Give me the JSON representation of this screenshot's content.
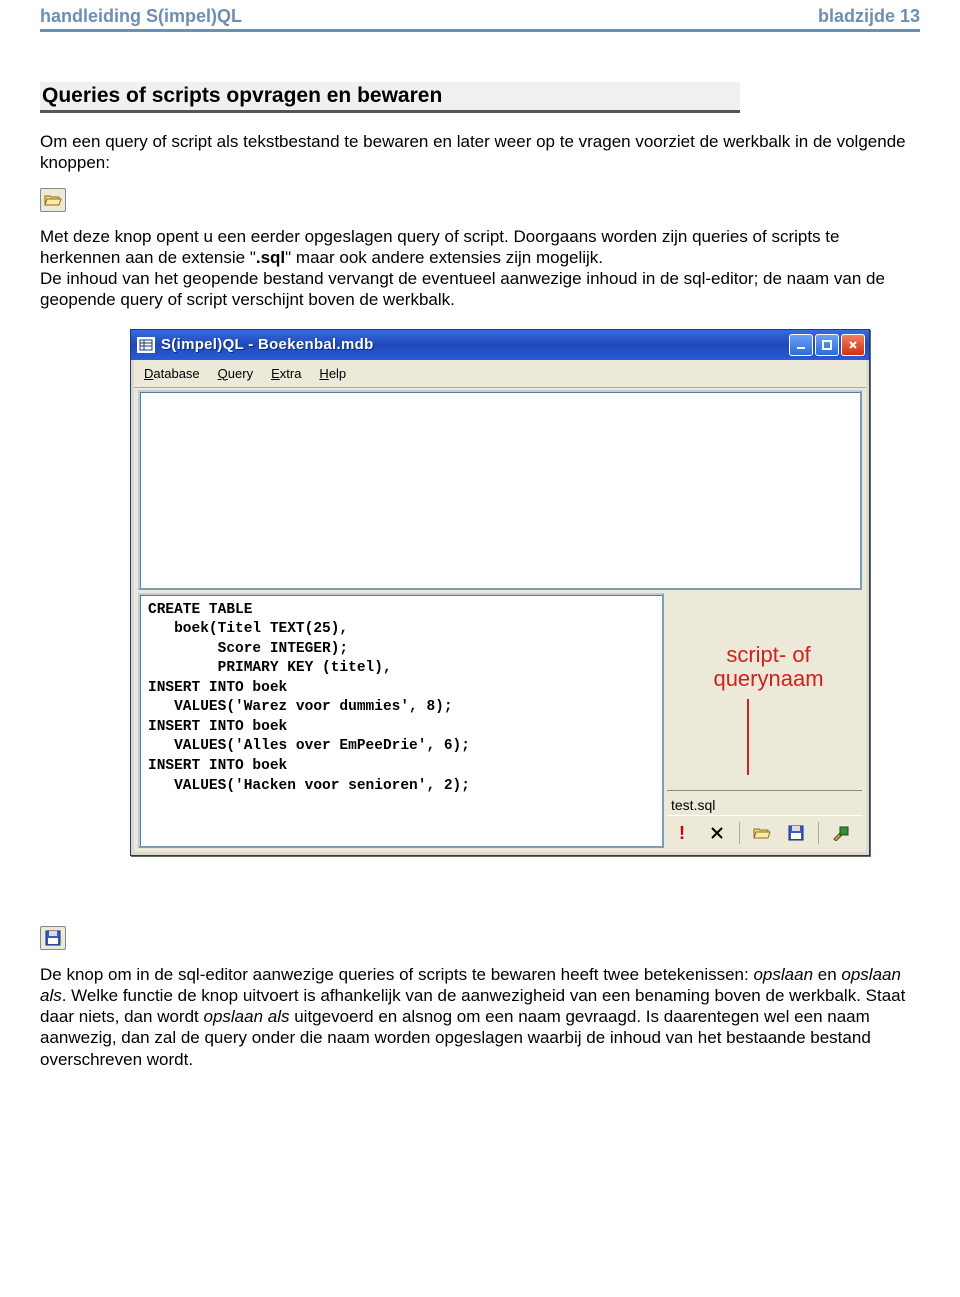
{
  "header": {
    "left": "handleiding S(impel)QL",
    "right": "bladzijde 13"
  },
  "section_title": "Queries of scripts opvragen en bewaren",
  "para1": "Om een query of script als tekstbestand te bewaren en later weer op te vragen voorziet de werkbalk in de volgende knoppen:",
  "para2a": "Met deze knop opent u een eerder opgeslagen query of script. Doorgaans worden zijn queries of scripts te herkennen aan de extensie \"",
  "para2b": ".sql",
  "para2c": "\" maar ook andere extensies zijn mogelijk.",
  "para2d": "De inhoud van het geopende bestand vervangt de eventueel aanwezige inhoud in de sql-editor; de naam van de geopende query of script verschijnt boven de werkbalk.",
  "window": {
    "title": "S(impel)QL - Boekenbal.mdb",
    "menu": {
      "database": "Database",
      "query": "Query",
      "extra": "Extra",
      "help": "Help"
    },
    "editor_code": "CREATE TABLE\n   boek(Titel TEXT(25),\n        Score INTEGER);\n        PRIMARY KEY (titel),\nINSERT INTO boek\n   VALUES('Warez voor dummies', 8);\nINSERT INTO boek\n   VALUES('Alles over EmPeeDrie', 6);\nINSERT INTO boek\n   VALUES('Hacken voor senioren', 2);",
    "callout": "script- of querynaam",
    "filename": "test.sql"
  },
  "para3a": "De knop om in de sql-editor aanwezige queries of scripts te bewaren heeft twee betekenissen: ",
  "para3b": "opslaan",
  "para3c": " en ",
  "para3d": "opslaan als",
  "para3e": ". Welke functie de knop uitvoert is afhankelijk van de aanwezigheid van een benaming boven de werkbalk. Staat daar niets, dan wordt ",
  "para3f": "opslaan als",
  "para3g": " uitgevoerd en alsnog om een naam gevraagd. Is daarentegen wel een naam aanwezig, dan zal de query onder die naam worden opgeslagen waarbij de inhoud van het bestaande bestand overschreven wordt."
}
